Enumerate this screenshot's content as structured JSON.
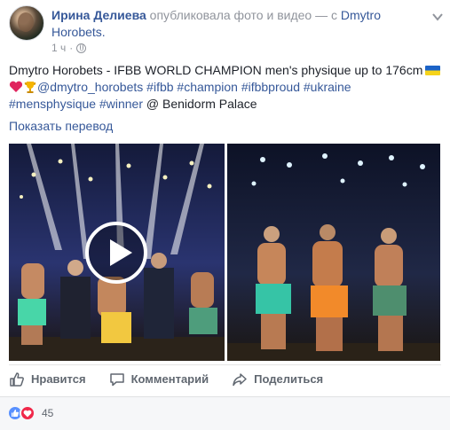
{
  "header": {
    "author": "Ирина Делиева",
    "verb": "опубликовала фото и видео — с",
    "tagged": "Dmytro Horobets.",
    "time": "1 ч",
    "separator": "·"
  },
  "post": {
    "line1": "Dmytro Horobets - IFBB WORLD CHAMPION men's physique up to 176cm",
    "mention": "@dmytro_horobets",
    "hashtags": [
      "#ifbb",
      "#champion",
      "#ifbbproud",
      "#ukraine",
      "#mensphysique",
      "#winner"
    ],
    "at": "@",
    "location": "Benidorm Palace",
    "translate": "Показать перевод"
  },
  "icons": {
    "globe": "globe-icon",
    "chevron": "chevron-down-icon",
    "flag": "ukraine-flag-icon",
    "heart": "heart-icon",
    "trophy": "trophy-icon",
    "play": "play-icon",
    "like": "thumbs-up-icon",
    "comment": "comment-icon",
    "share": "share-icon"
  },
  "actions": {
    "like": "Нравится",
    "comment": "Комментарий",
    "share": "Поделиться"
  },
  "reactions": {
    "count": "45"
  },
  "colors": {
    "link": "#365899",
    "muted": "#90949c",
    "like_blue": "#5890ff",
    "love_red": "#f0284a"
  }
}
